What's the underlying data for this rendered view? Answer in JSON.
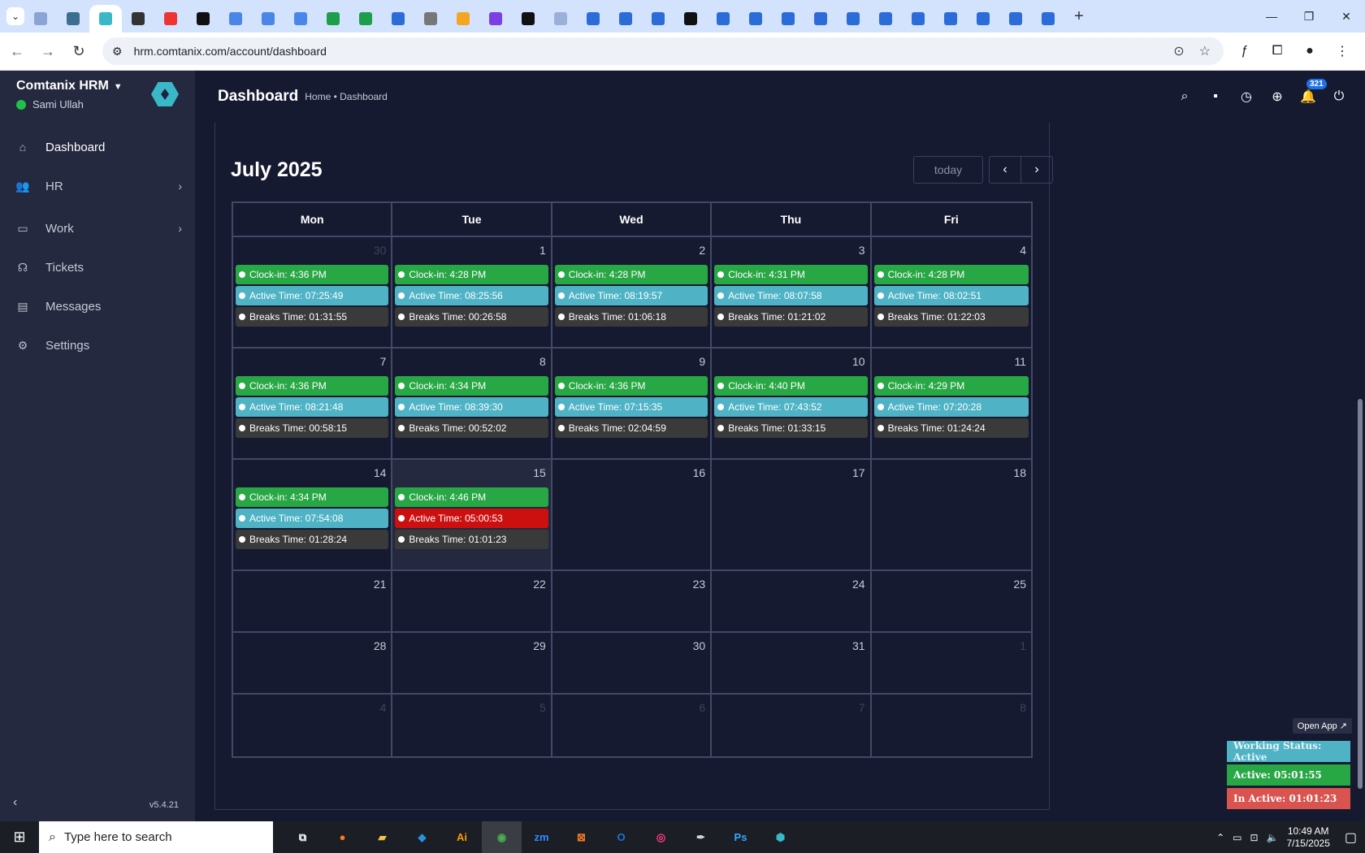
{
  "browser": {
    "tabs": [
      {
        "color": "#8aa4d6"
      },
      {
        "color": "#3c6e8f"
      },
      {
        "color": "#3ab8c8",
        "active": true
      },
      {
        "color": "#333333"
      },
      {
        "color": "#e33"
      },
      {
        "color": "#111"
      },
      {
        "color": "#4a86e8"
      },
      {
        "color": "#4a86e8"
      },
      {
        "color": "#4a86e8"
      },
      {
        "color": "#1e9e4a"
      },
      {
        "color": "#1e9e4a"
      },
      {
        "color": "#2b6cd8"
      },
      {
        "color": "#777"
      },
      {
        "color": "#f4a623"
      },
      {
        "color": "#7b3fe4"
      },
      {
        "color": "#111"
      },
      {
        "color": "#9bb0d8"
      },
      {
        "color": "#2b6cd8"
      },
      {
        "color": "#2b6cd8"
      },
      {
        "color": "#2b6cd8"
      },
      {
        "color": "#111"
      },
      {
        "color": "#2b6cd8"
      },
      {
        "color": "#2b6cd8"
      },
      {
        "color": "#2b6cd8"
      },
      {
        "color": "#2b6cd8"
      },
      {
        "color": "#2b6cd8"
      },
      {
        "color": "#2b6cd8"
      },
      {
        "color": "#2b6cd8"
      },
      {
        "color": "#2b6cd8"
      },
      {
        "color": "#2b6cd8"
      },
      {
        "color": "#2b6cd8"
      },
      {
        "color": "#2b6cd8"
      }
    ],
    "url": "hrm.comtanix.com/account/dashboard"
  },
  "sidebar": {
    "brand": "Comtanix HRM",
    "user": "Sami Ullah",
    "items": [
      {
        "label": "Dashboard",
        "icon": "home-icon",
        "glyph": "⌂"
      },
      {
        "label": "HR",
        "icon": "users-icon",
        "glyph": "👥"
      },
      {
        "label": "Work",
        "icon": "briefcase-icon",
        "glyph": "▭"
      },
      {
        "label": "Tickets",
        "icon": "headset-icon",
        "glyph": "☊"
      },
      {
        "label": "Messages",
        "icon": "message-icon",
        "glyph": "▤"
      },
      {
        "label": "Settings",
        "icon": "gear-icon",
        "glyph": "⚙"
      }
    ],
    "version": "v5.4.21"
  },
  "header": {
    "title": "Dashboard",
    "breadcrumb": "Home • Dashboard",
    "notification_count": "321"
  },
  "calendar": {
    "title": "July 2025",
    "today_label": "today",
    "days": [
      "Mon",
      "Tue",
      "Wed",
      "Thu",
      "Fri"
    ],
    "weeks": [
      [
        {
          "num": "30",
          "other": true,
          "clock": "Clock-in: 4:36 PM",
          "active": "Active Time: 07:25:49",
          "breaks": "Breaks Time: 01:31:55"
        },
        {
          "num": "1",
          "clock": "Clock-in: 4:28 PM",
          "active": "Active Time: 08:25:56",
          "breaks": "Breaks Time: 00:26:58"
        },
        {
          "num": "2",
          "clock": "Clock-in: 4:28 PM",
          "active": "Active Time: 08:19:57",
          "breaks": "Breaks Time: 01:06:18"
        },
        {
          "num": "3",
          "clock": "Clock-in: 4:31 PM",
          "active": "Active Time: 08:07:58",
          "breaks": "Breaks Time: 01:21:02"
        },
        {
          "num": "4",
          "clock": "Clock-in: 4:28 PM",
          "active": "Active Time: 08:02:51",
          "breaks": "Breaks Time: 01:22:03"
        }
      ],
      [
        {
          "num": "7",
          "clock": "Clock-in: 4:36 PM",
          "active": "Active Time: 08:21:48",
          "breaks": "Breaks Time: 00:58:15"
        },
        {
          "num": "8",
          "clock": "Clock-in: 4:34 PM",
          "active": "Active Time: 08:39:30",
          "breaks": "Breaks Time: 00:52:02"
        },
        {
          "num": "9",
          "clock": "Clock-in: 4:36 PM",
          "active": "Active Time: 07:15:35",
          "breaks": "Breaks Time: 02:04:59"
        },
        {
          "num": "10",
          "clock": "Clock-in: 4:40 PM",
          "active": "Active Time: 07:43:52",
          "breaks": "Breaks Time: 01:33:15"
        },
        {
          "num": "11",
          "clock": "Clock-in: 4:29 PM",
          "active": "Active Time: 07:20:28",
          "breaks": "Breaks Time: 01:24:24"
        }
      ],
      [
        {
          "num": "14",
          "clock": "Clock-in: 4:34 PM",
          "active": "Active Time: 07:54:08",
          "breaks": "Breaks Time: 01:28:24"
        },
        {
          "num": "15",
          "today": true,
          "bad": true,
          "clock": "Clock-in: 4:46 PM",
          "active": "Active Time: 05:00:53",
          "breaks": "Breaks Time: 01:01:23"
        },
        {
          "num": "16"
        },
        {
          "num": "17"
        },
        {
          "num": "18"
        }
      ],
      [
        {
          "num": "21"
        },
        {
          "num": "22"
        },
        {
          "num": "23"
        },
        {
          "num": "24"
        },
        {
          "num": "25"
        }
      ],
      [
        {
          "num": "28"
        },
        {
          "num": "29"
        },
        {
          "num": "30"
        },
        {
          "num": "31"
        },
        {
          "num": "1",
          "other": true
        }
      ],
      [
        {
          "num": "4",
          "other": true
        },
        {
          "num": "5",
          "other": true
        },
        {
          "num": "6",
          "other": true
        },
        {
          "num": "7",
          "other": true
        },
        {
          "num": "8",
          "other": true
        }
      ]
    ]
  },
  "widget": {
    "open_app": "Open App ↗",
    "status": "Working Status: Active",
    "active": "Active: 05:01:55",
    "inactive": "In Active: 01:01:23"
  },
  "taskbar": {
    "search_placeholder": "Type here to search",
    "apps": [
      {
        "name": "task-view-icon",
        "glyph": "⧉",
        "color": "#fff"
      },
      {
        "name": "firefox-icon",
        "glyph": "●",
        "color": "#ff7a1a"
      },
      {
        "name": "file-explorer-icon",
        "glyph": "▰",
        "color": "#f3c44b"
      },
      {
        "name": "vscode-icon",
        "glyph": "◆",
        "color": "#2c8fe0"
      },
      {
        "name": "illustrator-icon",
        "glyph": "Ai",
        "color": "#ff9a00"
      },
      {
        "name": "chrome-icon",
        "glyph": "◉",
        "color": "#4caf50",
        "running": true
      },
      {
        "name": "zoom-icon",
        "glyph": "zm",
        "color": "#2d8cff"
      },
      {
        "name": "xampp-icon",
        "glyph": "⊠",
        "color": "#fb7a24"
      },
      {
        "name": "outlook-icon",
        "glyph": "O",
        "color": "#1b74d4"
      },
      {
        "name": "creative-cloud-icon",
        "glyph": "◎",
        "color": "#ff3b7f"
      },
      {
        "name": "pen-tool-icon",
        "glyph": "✒",
        "color": "#ddd"
      },
      {
        "name": "photoshop-icon",
        "glyph": "Ps",
        "color": "#31a8ff"
      },
      {
        "name": "hrm-app-icon",
        "glyph": "⬢",
        "color": "#3ab8c8"
      }
    ],
    "time": "10:49 AM",
    "date": "7/15/2025"
  }
}
